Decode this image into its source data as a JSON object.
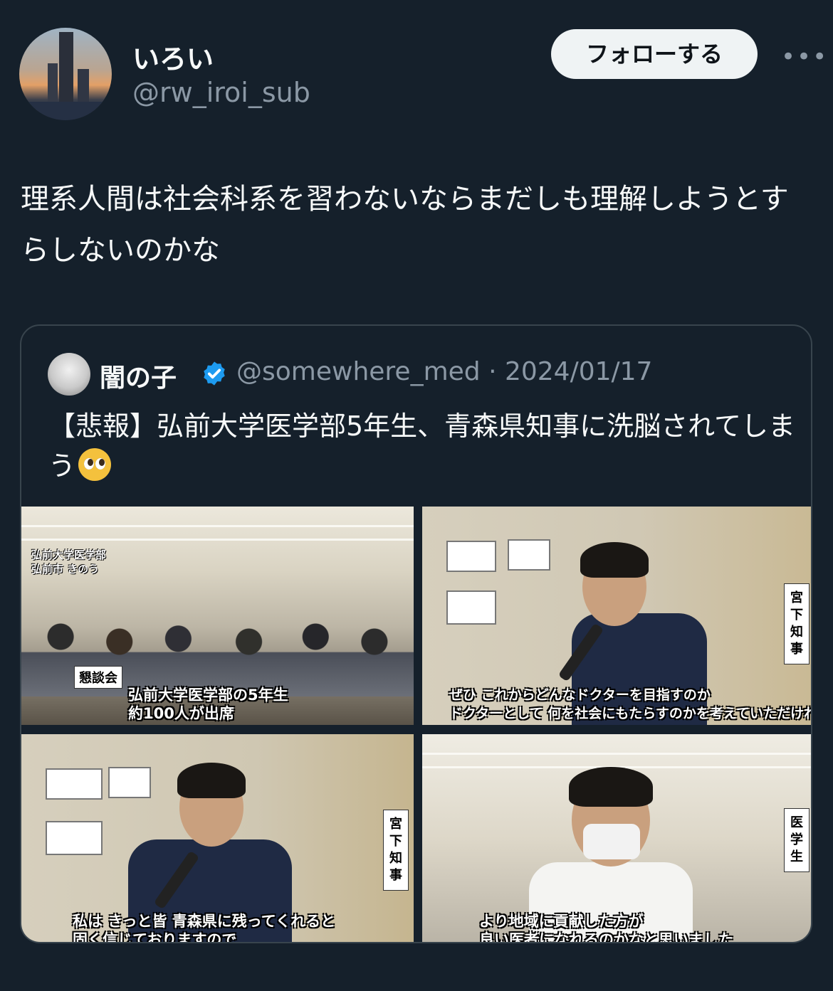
{
  "user": {
    "display_name": "いろい",
    "handle": "@rw_iroi_sub",
    "follow_label": "フォローする",
    "more_icon": "more-horizontal-icon"
  },
  "tweet": {
    "text": "理系人間は社会科系を習わないならまだしも理解しようとすらしないのかな"
  },
  "quote": {
    "display_name": "闇の子",
    "verified_icon": "verified-badge-icon",
    "handle_date": "@somewhere_med · 2024/01/17",
    "text": "【悲報】弘前大学医学部5年生、青森県知事に洗脳されてしまう",
    "emoji": "pleading-face-emoji",
    "media": [
      {
        "location_line1": "弘前大学医学部",
        "location_line2": "弘前市 きのう",
        "tag": "懇談会",
        "caption_line1": "弘前大学医学部の5年生",
        "caption_line2": "約100人が出席"
      },
      {
        "vertical_tag": "宮下知事",
        "caption_line1": "ぜひ これからどんなドクターを目指すのか",
        "caption_line2": "ドクターとして 何を社会にもたらすのかを考えていただければ"
      },
      {
        "vertical_tag": "宮下知事",
        "caption_line1": "私は きっと皆 青森県に残ってくれると",
        "caption_line2": "固く信じておりますので"
      },
      {
        "vertical_tag": "医学生",
        "caption_line1": "より地域に貢献した方が",
        "caption_line2": "良い医者になれるのかなと思いました"
      }
    ]
  }
}
